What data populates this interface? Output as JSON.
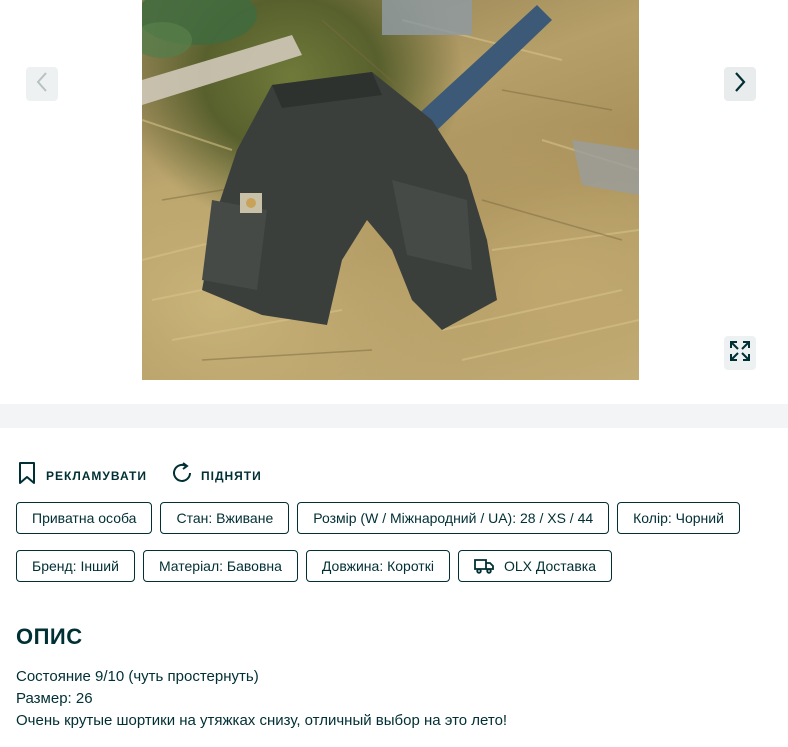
{
  "gallery": {
    "prev_icon": "chevron-left-icon",
    "next_icon": "chevron-right-icon",
    "fullscreen_icon": "expand-icon"
  },
  "actions": [
    {
      "label": "РЕКЛАМУВАТИ",
      "icon": "bookmark-icon"
    },
    {
      "label": "ПІДНЯТИ",
      "icon": "refresh-icon"
    }
  ],
  "tags": {
    "row1": [
      "Приватна особа",
      "Стан: Вживане",
      "Розмір (W / Міжнародний / UA): 28 / XS / 44",
      "Колір: Чорний"
    ],
    "row2": [
      "Бренд: Інший",
      "Матеріал: Бавовна",
      "Довжина: Короткі"
    ],
    "delivery": "OLX Доставка"
  },
  "description": {
    "title": "ОПИС",
    "lines": [
      "Состояние 9/10 (чуть простернуть)",
      "Размер: 26",
      "Очень крутые шортики на утяжках снизу, отличный выбор на это лето!"
    ]
  },
  "colors": {
    "text": "#002f34",
    "band": "#f2f4f5"
  }
}
